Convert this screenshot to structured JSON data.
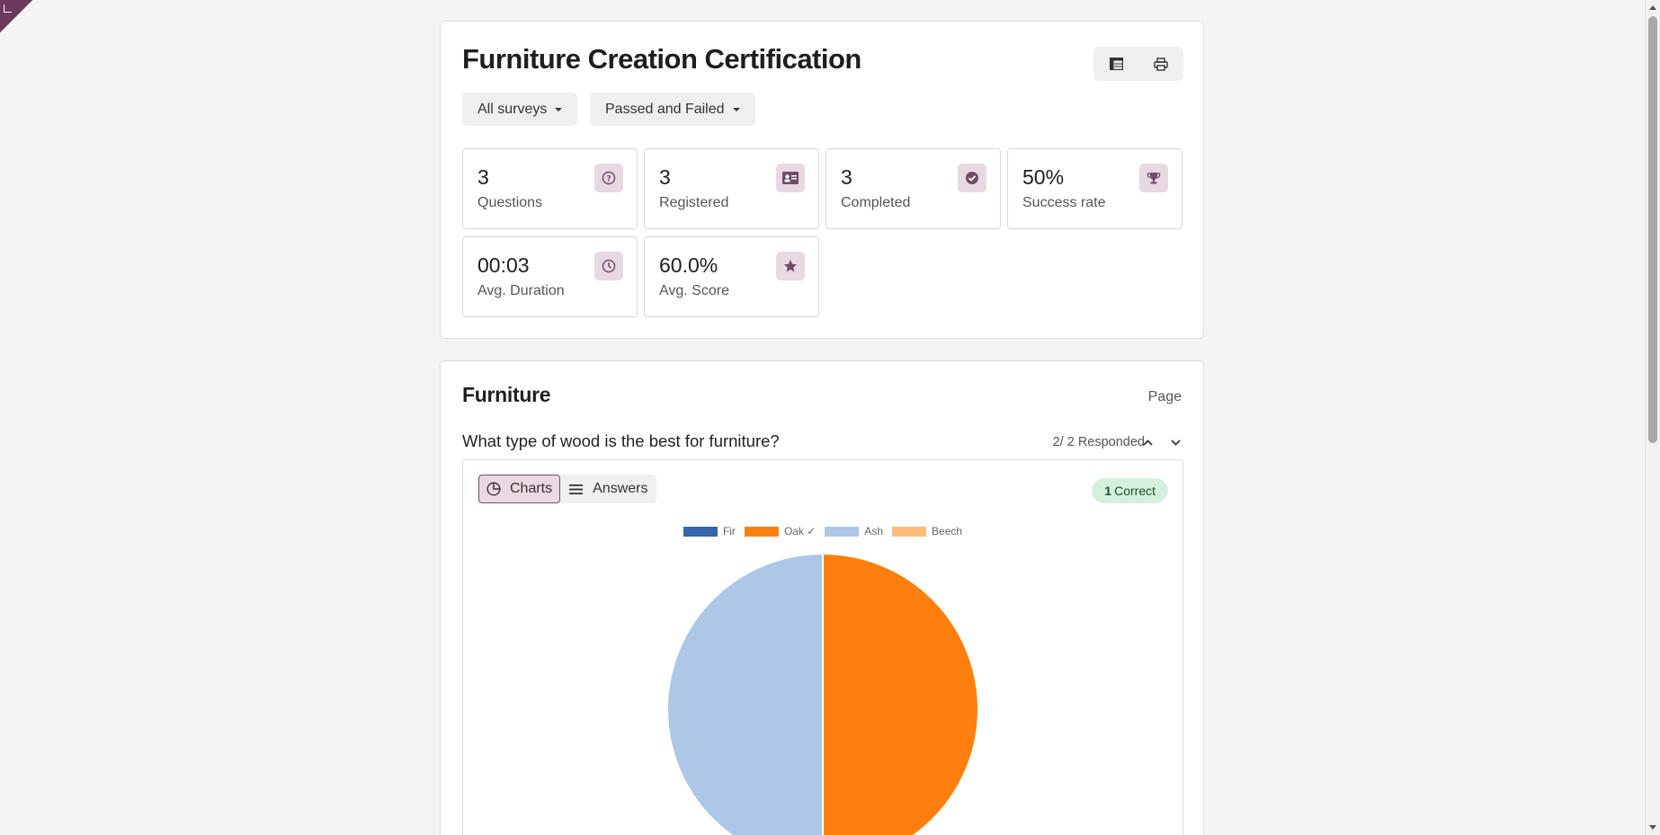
{
  "summary": {
    "title": "Furniture Creation Certification",
    "filters": [
      {
        "label": "All surveys"
      },
      {
        "label": "Passed and Failed"
      }
    ],
    "stats": [
      {
        "value": "3",
        "label": "Questions",
        "icon": "question-circle-icon"
      },
      {
        "value": "3",
        "label": "Registered",
        "icon": "id-card-icon"
      },
      {
        "value": "3",
        "label": "Completed",
        "icon": "check-circle-icon"
      },
      {
        "value": "50%",
        "label": "Success rate",
        "icon": "trophy-icon"
      },
      {
        "value": "00:03",
        "label": "Avg. Duration",
        "icon": "clock-icon"
      },
      {
        "value": "60.0%",
        "label": "Avg. Score",
        "icon": "star-icon"
      }
    ]
  },
  "section": {
    "title": "Furniture",
    "page_label": "Page",
    "question": {
      "title": "What type of wood is the best for furniture?",
      "responded": "2/ 2 Responded",
      "tabs": [
        {
          "label": "Charts",
          "icon": "pie-chart-icon",
          "active": true
        },
        {
          "label": "Answers",
          "icon": "list-icon",
          "active": false
        }
      ],
      "correct_count": "1",
      "correct_label": "Correct"
    }
  },
  "chart_data": {
    "type": "pie",
    "categories": [
      "Fir",
      "Oak ✓",
      "Ash",
      "Beech"
    ],
    "values": [
      0,
      1,
      1,
      0
    ],
    "colors": [
      "#3366aa",
      "#ff7f0e",
      "#aec7e8",
      "#ffbb78"
    ],
    "legend_position": "top-center"
  },
  "colors": {
    "brand": "#714b67",
    "icon_bg": "#e8d8e2",
    "badge_bg": "#d4f0dc"
  }
}
